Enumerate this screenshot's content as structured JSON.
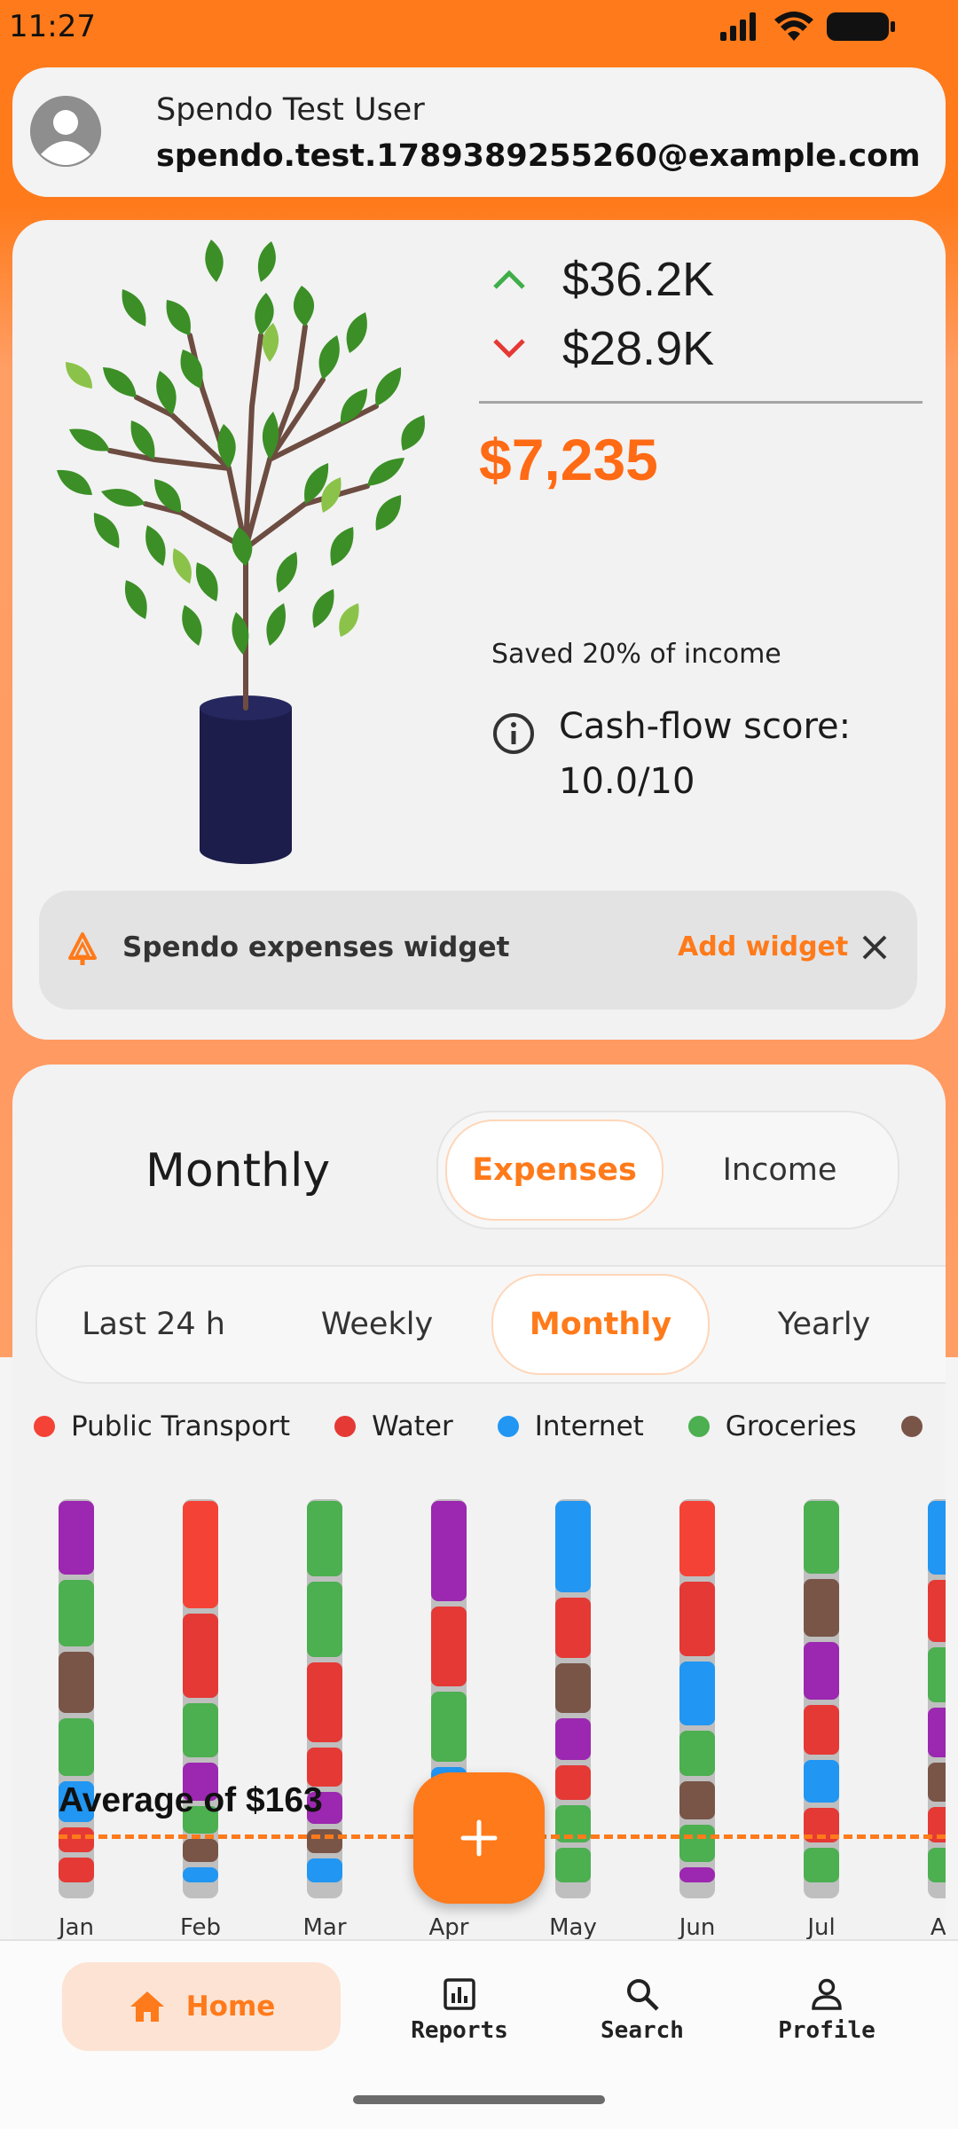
{
  "status": {
    "time": "11:27"
  },
  "user": {
    "name": "Spendo Test User",
    "email": "spendo.test.1789389255260@example.com"
  },
  "summary": {
    "income": "$36.2K",
    "expenses": "$28.9K",
    "balance": "$7,235",
    "saved": "Saved 20% of income",
    "score": "Cash-flow score: 10.0/10"
  },
  "widget": {
    "label": "Spendo expenses widget",
    "add": "Add widget"
  },
  "chart_section": {
    "title": "Monthly",
    "type_tabs": [
      "Expenses",
      "Income"
    ],
    "period_tabs": [
      "Last 24 h",
      "Weekly",
      "Monthly",
      "Yearly"
    ]
  },
  "colors": {
    "accent": "#ff7a1a",
    "income_up": "#3fae49",
    "expense_down": "#e53935"
  },
  "chart_data": {
    "type": "bar",
    "stacked": true,
    "legend": [
      {
        "name": "Public Transport",
        "color": "#f44336"
      },
      {
        "name": "Water",
        "color": "#e53935"
      },
      {
        "name": "Internet",
        "color": "#2196f3"
      },
      {
        "name": "Groceries",
        "color": "#4caf50"
      },
      {
        "name": "",
        "color": "#795548"
      }
    ],
    "categories": [
      "Jan",
      "Feb",
      "Mar",
      "Apr",
      "May",
      "Jun",
      "Jul",
      "Aug"
    ],
    "visible_labels": [
      "Jan",
      "Feb",
      "Mar",
      "Apr",
      "May",
      "Jun",
      "Jul",
      "Au"
    ],
    "average_label": "Average of $163",
    "segment_colors": [
      [
        "#9c27b0",
        "#4caf50",
        "#795548",
        "#4caf50",
        "#2196f3",
        "#e53935",
        "#e53935"
      ],
      [
        "#f44336",
        "#e53935",
        "#4caf50",
        "#9c27b0",
        "#4caf50",
        "#795548",
        "#2196f3"
      ],
      [
        "#4caf50",
        "#4caf50",
        "#e53935",
        "#e53935",
        "#9c27b0",
        "#795548",
        "#2196f3"
      ],
      [
        "#9c27b0",
        "#e53935",
        "#4caf50",
        "#2196f3",
        "#e53935"
      ],
      [
        "#2196f3",
        "#e53935",
        "#795548",
        "#9c27b0",
        "#e53935",
        "#4caf50",
        "#4caf50"
      ],
      [
        "#f44336",
        "#e53935",
        "#2196f3",
        "#4caf50",
        "#795548",
        "#4caf50",
        "#9c27b0"
      ],
      [
        "#4caf50",
        "#795548",
        "#9c27b0",
        "#e53935",
        "#2196f3",
        "#e53935",
        "#4caf50"
      ],
      [
        "#2196f3",
        "#e53935",
        "#4caf50",
        "#9c27b0",
        "#795548",
        "#e53935",
        "#4caf50"
      ]
    ],
    "segment_weights": [
      [
        18,
        16,
        15,
        14,
        10,
        6,
        6
      ],
      [
        28,
        22,
        14,
        10,
        7,
        6,
        4
      ],
      [
        19,
        19,
        20,
        10,
        8,
        6,
        6
      ],
      [
        20,
        16,
        14,
        12,
        10
      ],
      [
        24,
        16,
        13,
        11,
        9,
        10,
        9
      ],
      [
        20,
        20,
        17,
        12,
        10,
        10,
        4
      ],
      [
        19,
        15,
        15,
        13,
        11,
        9,
        9
      ],
      [
        19,
        16,
        14,
        13,
        10,
        9,
        9
      ]
    ]
  },
  "nav": {
    "home": "Home",
    "reports": "Reports",
    "search": "Search",
    "profile": "Profile"
  }
}
